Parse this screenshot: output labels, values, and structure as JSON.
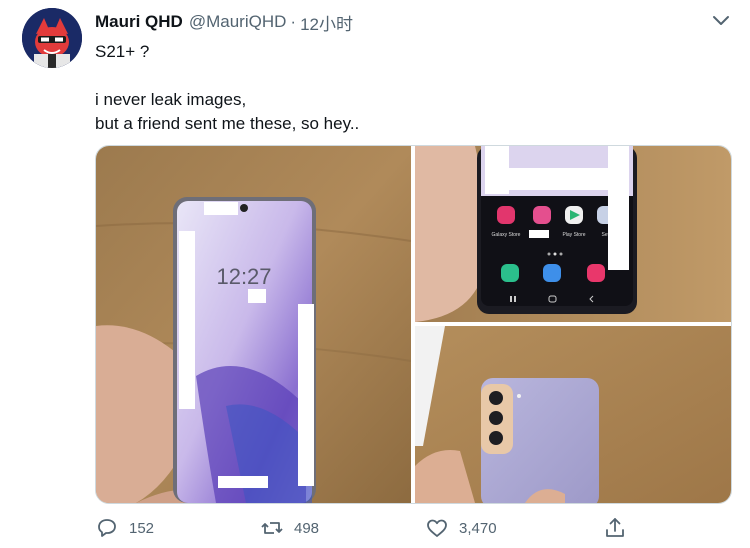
{
  "tweet": {
    "author_name": "Mauri QHD",
    "author_handle": "@MauriQHD",
    "separator": "·",
    "timestamp": "12小时",
    "lines": [
      "S21+ ?",
      "i never leak images,",
      "but a friend sent me these, so hey.."
    ]
  },
  "media": {
    "photo1": {
      "lock_time": "12:27"
    },
    "photo2": {
      "app_labels": [
        "Galaxy Store",
        "Play Store",
        "Sett"
      ]
    }
  },
  "actions": {
    "reply_count": "152",
    "retweet_count": "498",
    "like_count": "3,470"
  },
  "icons": [
    "caret-down-icon",
    "reply-icon",
    "retweet-icon",
    "like-icon",
    "share-icon"
  ],
  "colors": {
    "icon_gray": "#536471",
    "text": "#0f1419",
    "border": "#cfd9de"
  }
}
